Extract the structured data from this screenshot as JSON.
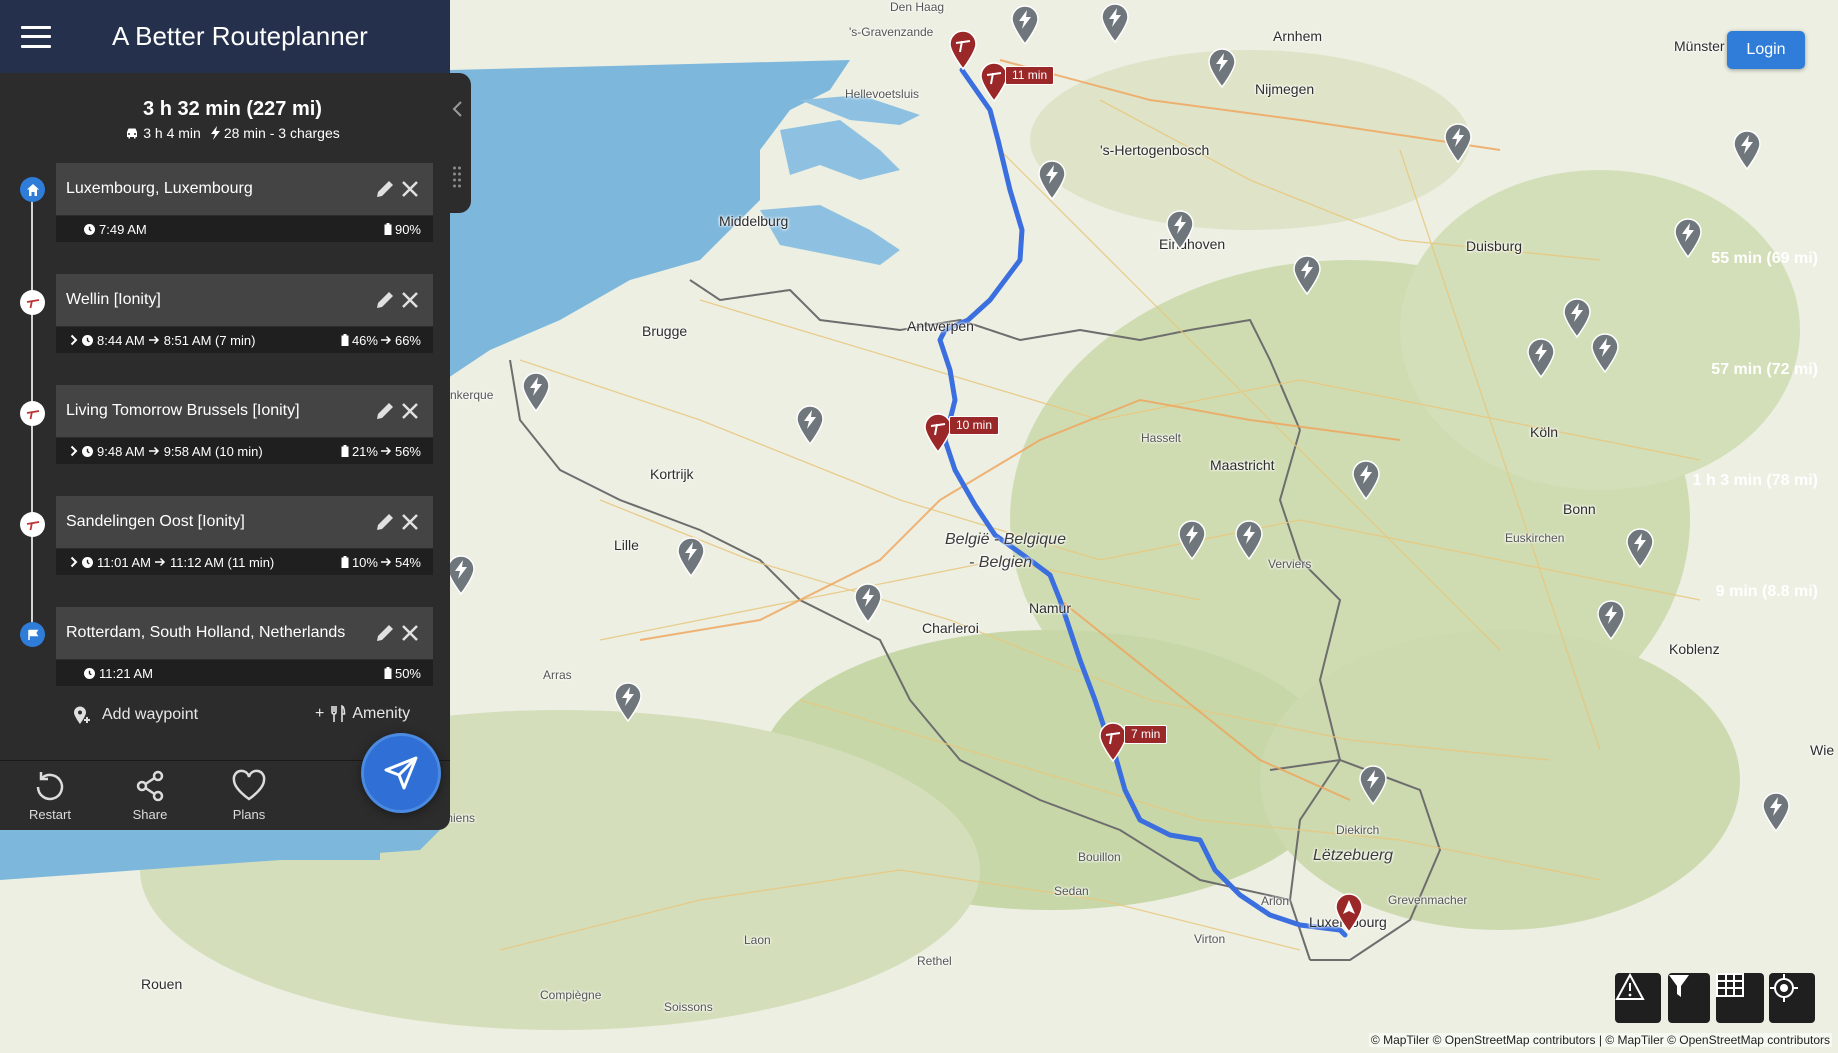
{
  "app": {
    "title": "A Better Routeplanner",
    "login_label": "Login"
  },
  "summary": {
    "total": "3 h 32 min (227 mi)",
    "drive": "3 h 4 min",
    "charge": "28 min - 3 charges"
  },
  "waypoints": [
    {
      "name": "Luxembourg, Luxembourg",
      "time": "7:49 AM",
      "battery": "90%"
    },
    {
      "name": "Wellin [Ionity]",
      "arrive": "8:44 AM",
      "depart": "8:51 AM (7 min)",
      "soc_arrive": "46%",
      "soc_depart": "66%"
    },
    {
      "name": "Living Tomorrow Brussels [Ionity]",
      "arrive": "9:48 AM",
      "depart": "9:58 AM (10 min)",
      "soc_arrive": "21%",
      "soc_depart": "56%"
    },
    {
      "name": "Sandelingen Oost [Ionity]",
      "arrive": "11:01 AM",
      "depart": "11:12 AM (11 min)",
      "soc_arrive": "10%",
      "soc_depart": "54%"
    },
    {
      "name": "Rotterdam, South Holland, Netherlands",
      "time": "11:21 AM",
      "battery": "50%"
    }
  ],
  "legs": [
    "55 min (69 mi)",
    "57 min (72 mi)",
    "1 h 3 min (78 mi)",
    "9 min (8.8 mi)"
  ],
  "actions": {
    "add_waypoint": "Add waypoint",
    "amenity": "Amenity",
    "amenity_prefix": "+"
  },
  "bottom_bar": {
    "restart": "Restart",
    "share": "Share",
    "plans": "Plans"
  },
  "map": {
    "stop_tags": [
      "11 min",
      "10 min",
      "7 min"
    ],
    "cities": [
      "'s-Gravenzande",
      "Den Haag",
      "Hellevoetsluis",
      "Arnhem",
      "Nijmegen",
      "Münster",
      "'s-Hertogenbosch",
      "Middelburg",
      "Eindhoven",
      "Duisburg",
      "Brugge",
      "Antwerpen",
      "Kortrijk",
      "Hasselt",
      "Köln",
      "Maastricht",
      "Lille",
      "Bonn",
      "Euskirchen",
      "Verviers",
      "Namur",
      "Charleroi",
      "Koblenz",
      "Arras",
      "Wie",
      "Lëtzebuerg",
      "Diekirch",
      "Bouillon",
      "Sedan",
      "Arlon",
      "Grevenmacher",
      "Luxembourg",
      "Virton",
      "Laon",
      "Rethel",
      "Rouen",
      "Compiègne",
      "Soissons",
      "nkerque",
      "Amiens"
    ],
    "country_label": [
      "België - Belgique",
      "- Belgien"
    ],
    "attribution": "© MapTiler © OpenStreetMap contributors | © MapTiler © OpenStreetMap contributors"
  },
  "colors": {
    "header": "#24304c",
    "panel": "#2c2c2c",
    "card": "#444444",
    "accent": "#2f7dd8",
    "route": "#3b6fe0",
    "stop_marker": "#9b2828"
  },
  "icons": [
    "menu-icon",
    "home-icon",
    "charger-icon",
    "flag-icon",
    "pencil-icon",
    "close-icon",
    "clock-icon",
    "battery-icon",
    "chevron-right-icon",
    "arrow-right-icon",
    "car-icon",
    "bolt-icon",
    "add-location-icon",
    "restaurant-icon",
    "restart-icon",
    "share-icon",
    "heart-icon",
    "send-icon",
    "warning-icon",
    "filter-icon",
    "grid-icon",
    "locate-icon",
    "chevron-left-icon",
    "drag-icon"
  ]
}
